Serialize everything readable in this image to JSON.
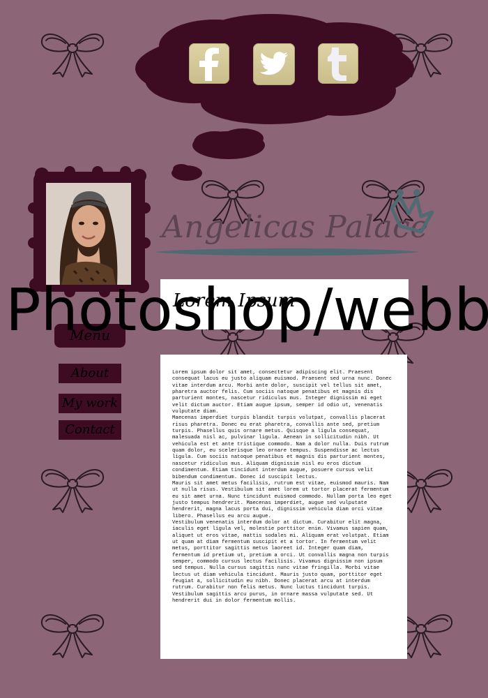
{
  "social": {
    "facebook_icon": "facebook-icon",
    "twitter_icon": "twitter-icon",
    "tumblr_icon": "tumblr-icon",
    "button_color": "#d4c99a"
  },
  "logo": {
    "text": "Angelicas Palace",
    "crown_icon": "crown-icon"
  },
  "watermark": "Photoshop/webb",
  "header": {
    "title": "Lorem Ipsum"
  },
  "menu": {
    "title": "Menu",
    "items": [
      "About",
      "My work",
      "Contact"
    ]
  },
  "content": {
    "paragraphs": [
      "Lorem ipsum dolor sit amet, consectetur adipiscing elit. Praesent consequat lacus eu justo aliquam euismod. Praesent sed urna nunc. Donec vitae interdum arcu. Morbi ante dolor, suscipit vel tellus sit amet, pharetra auctor felis. Cum sociis natoque penatibus et magnis dis parturient montes, nascetur ridiculus mus. Integer dignissim mi eget velit dictum auctor. Etiam augue ipsum, semper id odio ut, venenatis vulputate diam.",
      "Maecenas imperdiet turpis blandit turpis volutpat, convallis placerat risus pharetra. Donec eu erat pharetra, convallis ante sed, pretium turpis. Phasellus quis ornare metus. Quisque a ligula consequat, malesuada nisl ac, pulvinar ligula. Aenean in sollicitudin nibh. Ut vehicula est et ante tristique commodo. Nam a dolor nulla. Duis rutrum quam dolor, eu scelerisque leo ornare tempus. Suspendisse ac lectus ligula. Cum sociis natoque penatibus et magnis dis parturient montes, nascetur ridiculus mus. Aliquam dignissim nisl eu eros dictum condimentum. Etiam tincidunt interdum augue, posuere cursus velit bibendum condimentum. Donec id suscipit lectus.",
      "Mauris sit amet metus facilisis, rutrum est vitae, euismod mauris. Nam ut nulla risus. Vestibulum sit amet lorem ut tortor placerat fermentum eu sit amet urna. Nunc tincidunt euismod commodo. Nullam porta leo eget justo tempus hendrerit. Maecenas imperdiet, augue sed vulputate hendrerit, magna lacus porta dui, dignissim vehicula diam orci vitae libero. Phasellus eu arcu augue.",
      "Vestibulum venenatis interdum dolor at dictum. Curabitur elit magna, iaculis eget ligula vel, molestie porttitor enim. Vivamus sapien quam, aliquet ut eros vitae, mattis sodales mi. Aliquam erat volutpat. Etiam ut quam at diam fermentum suscipit et a tortor. In fermentum velit metus, porttitor sagittis metus laoreet id. Integer quam diam, fermentum id pretium ut, pretium a orci. Ut convallis magna non turpis semper, commodo cursus lectus facilisis. Vivamus dignissim non ipsum sed tempus. Nulla cursus sagittis nunc vitae fringilla. Morbi vitae lectus ut diam vehicula tincidunt. Mauris justo quam, porttitor eget feugiat a, sollicitudin eu nibh. Donec placerat arcu at interdum rutrum. Curabitur non felis metus. Nunc luctus tincidunt turpis. Vestibulum sagittis arcu purus, in ornare massa vulputate sed. Ut hendrerit dui in dolor fermentum mollis."
    ]
  },
  "colors": {
    "background": "#8c6676",
    "dark_accent": "#3e0c22",
    "logo_text": "#5d4452",
    "logo_line": "#4f6a72",
    "crown": "#4f6a72"
  }
}
